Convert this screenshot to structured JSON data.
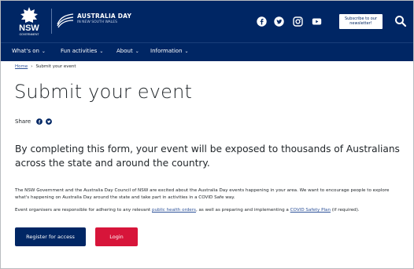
{
  "header": {
    "nsw_wordmark": "NSW",
    "nsw_sub": "GOVERNMENT",
    "brand_title": "AUSTRALIA DAY",
    "brand_sub": "IN NEW SOUTH WALES",
    "social_icons": [
      "facebook-icon",
      "twitter-icon",
      "instagram-icon",
      "youtube-icon"
    ],
    "subscribe_label_1": "Subscribe to our",
    "subscribe_label_2": "newsletter!",
    "search_icon": "search-icon"
  },
  "nav": {
    "items": [
      {
        "label": "What's on"
      },
      {
        "label": "Fun activities"
      },
      {
        "label": "About"
      },
      {
        "label": "Information"
      }
    ]
  },
  "breadcrumb": {
    "home": "Home",
    "separator": "›",
    "current": "Submit your event"
  },
  "page": {
    "title": "Submit your event",
    "share_label": "Share",
    "lead": "By completing this form, your event will be exposed to thousands of Australians across the state and around the country.",
    "para1": "The NSW Government and the Australia Day Council of NSW are excited about the Australia Day events happening in your area. We want to encourage people to explore what's happening on Australia Day around the state and take part in activities in a COVID Safe way.",
    "para2_start": "Event organisers are responsible for adhering to any relevant ",
    "para2_link1": "public health orders",
    "para2_mid": ", as well as preparing and implementing a ",
    "para2_link2": "COVID Safety Plan",
    "para2_end": " (if required)."
  },
  "actions": {
    "register_label": "Register for access",
    "login_label": "Login"
  },
  "colors": {
    "brand_navy": "#002664",
    "login_red": "#d7153a",
    "link_blue": "#2e5299"
  }
}
